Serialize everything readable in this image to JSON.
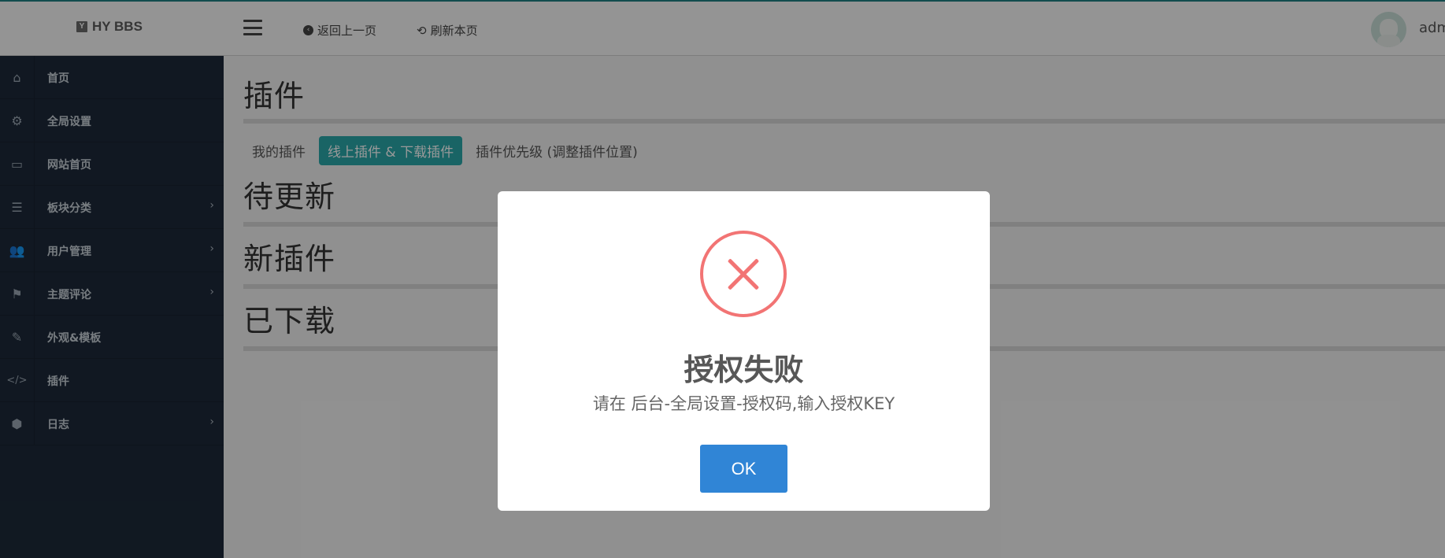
{
  "header": {
    "brand": "HY BBS",
    "brand_icon_glyph": "Y",
    "back_label": "返回上一页",
    "refresh_label": "刷新本页",
    "user_name": "adm"
  },
  "sidebar": {
    "items": [
      {
        "label": "首页",
        "icon": "home-icon",
        "glyph": "⌂"
      },
      {
        "label": "全局设置",
        "icon": "gear-icon",
        "glyph": "⚙"
      },
      {
        "label": "网站首页",
        "icon": "desktop-icon",
        "glyph": "▭"
      },
      {
        "label": "板块分类",
        "icon": "list-icon",
        "glyph": "☰",
        "arrow": "›"
      },
      {
        "label": "用户管理",
        "icon": "users-icon",
        "glyph": "👥",
        "arrow": "›"
      },
      {
        "label": "主题评论",
        "icon": "tags-icon",
        "glyph": "⚑",
        "arrow": "›"
      },
      {
        "label": "外观&模板",
        "icon": "brush-icon",
        "glyph": "✎"
      },
      {
        "label": "插件",
        "icon": "code-icon",
        "glyph": "</>"
      },
      {
        "label": "日志",
        "icon": "cube-icon",
        "glyph": "⬢",
        "arrow": "›"
      }
    ]
  },
  "main": {
    "title": "插件",
    "tabs": [
      {
        "label": "我的插件",
        "active": false
      },
      {
        "label": "线上插件 & 下载插件",
        "active": true
      },
      {
        "label": "插件优先级 (调整插件位置)",
        "active": false
      }
    ],
    "sections": [
      "待更新",
      "新插件",
      "已下载"
    ]
  },
  "dialog": {
    "title": "授权失败",
    "text": "请在 后台-全局设置-授权码,输入授权KEY",
    "ok_label": "OK"
  },
  "colors": {
    "accent": "#1f7f83",
    "active_tab": "#2aa7a8",
    "sidebar_bg": "#1d2939",
    "error_red": "#f27474",
    "ok_button": "#3085d6"
  }
}
